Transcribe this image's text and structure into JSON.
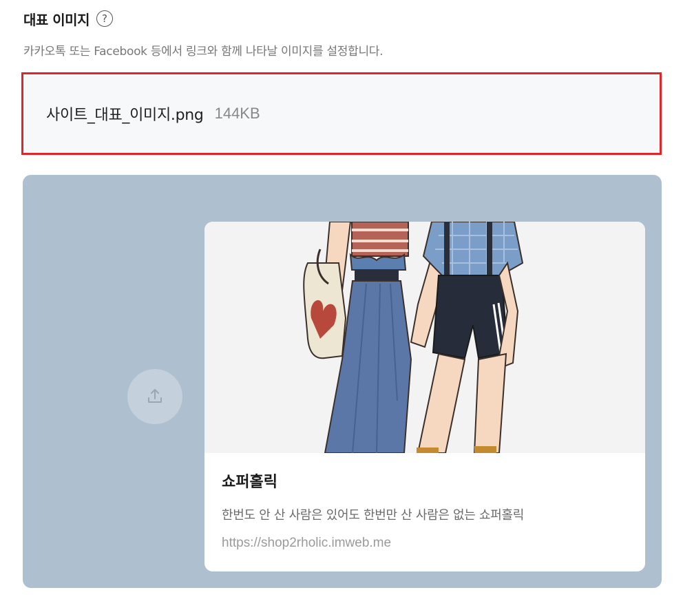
{
  "section": {
    "title": "대표 이미지",
    "help_icon": "question-circle-icon",
    "description": "카카오톡 또는 Facebook 등에서 링크와 함께 나타날 이미지를 설정합니다."
  },
  "file": {
    "name": "사이트_대표_이미지.png",
    "size": "144KB"
  },
  "preview": {
    "upload_icon": "upload-icon",
    "image": "two-people-illustration",
    "title": "쇼퍼홀릭",
    "description": "한번도 안 산 사람은 있어도 한번만 산 사람은 없는 쇼퍼홀릭",
    "url": "https://shop2rholic.imweb.me"
  },
  "colors": {
    "highlight_border": "#e0242b",
    "preview_background": "#aec0cf",
    "file_box_background": "#f7f8fa"
  }
}
